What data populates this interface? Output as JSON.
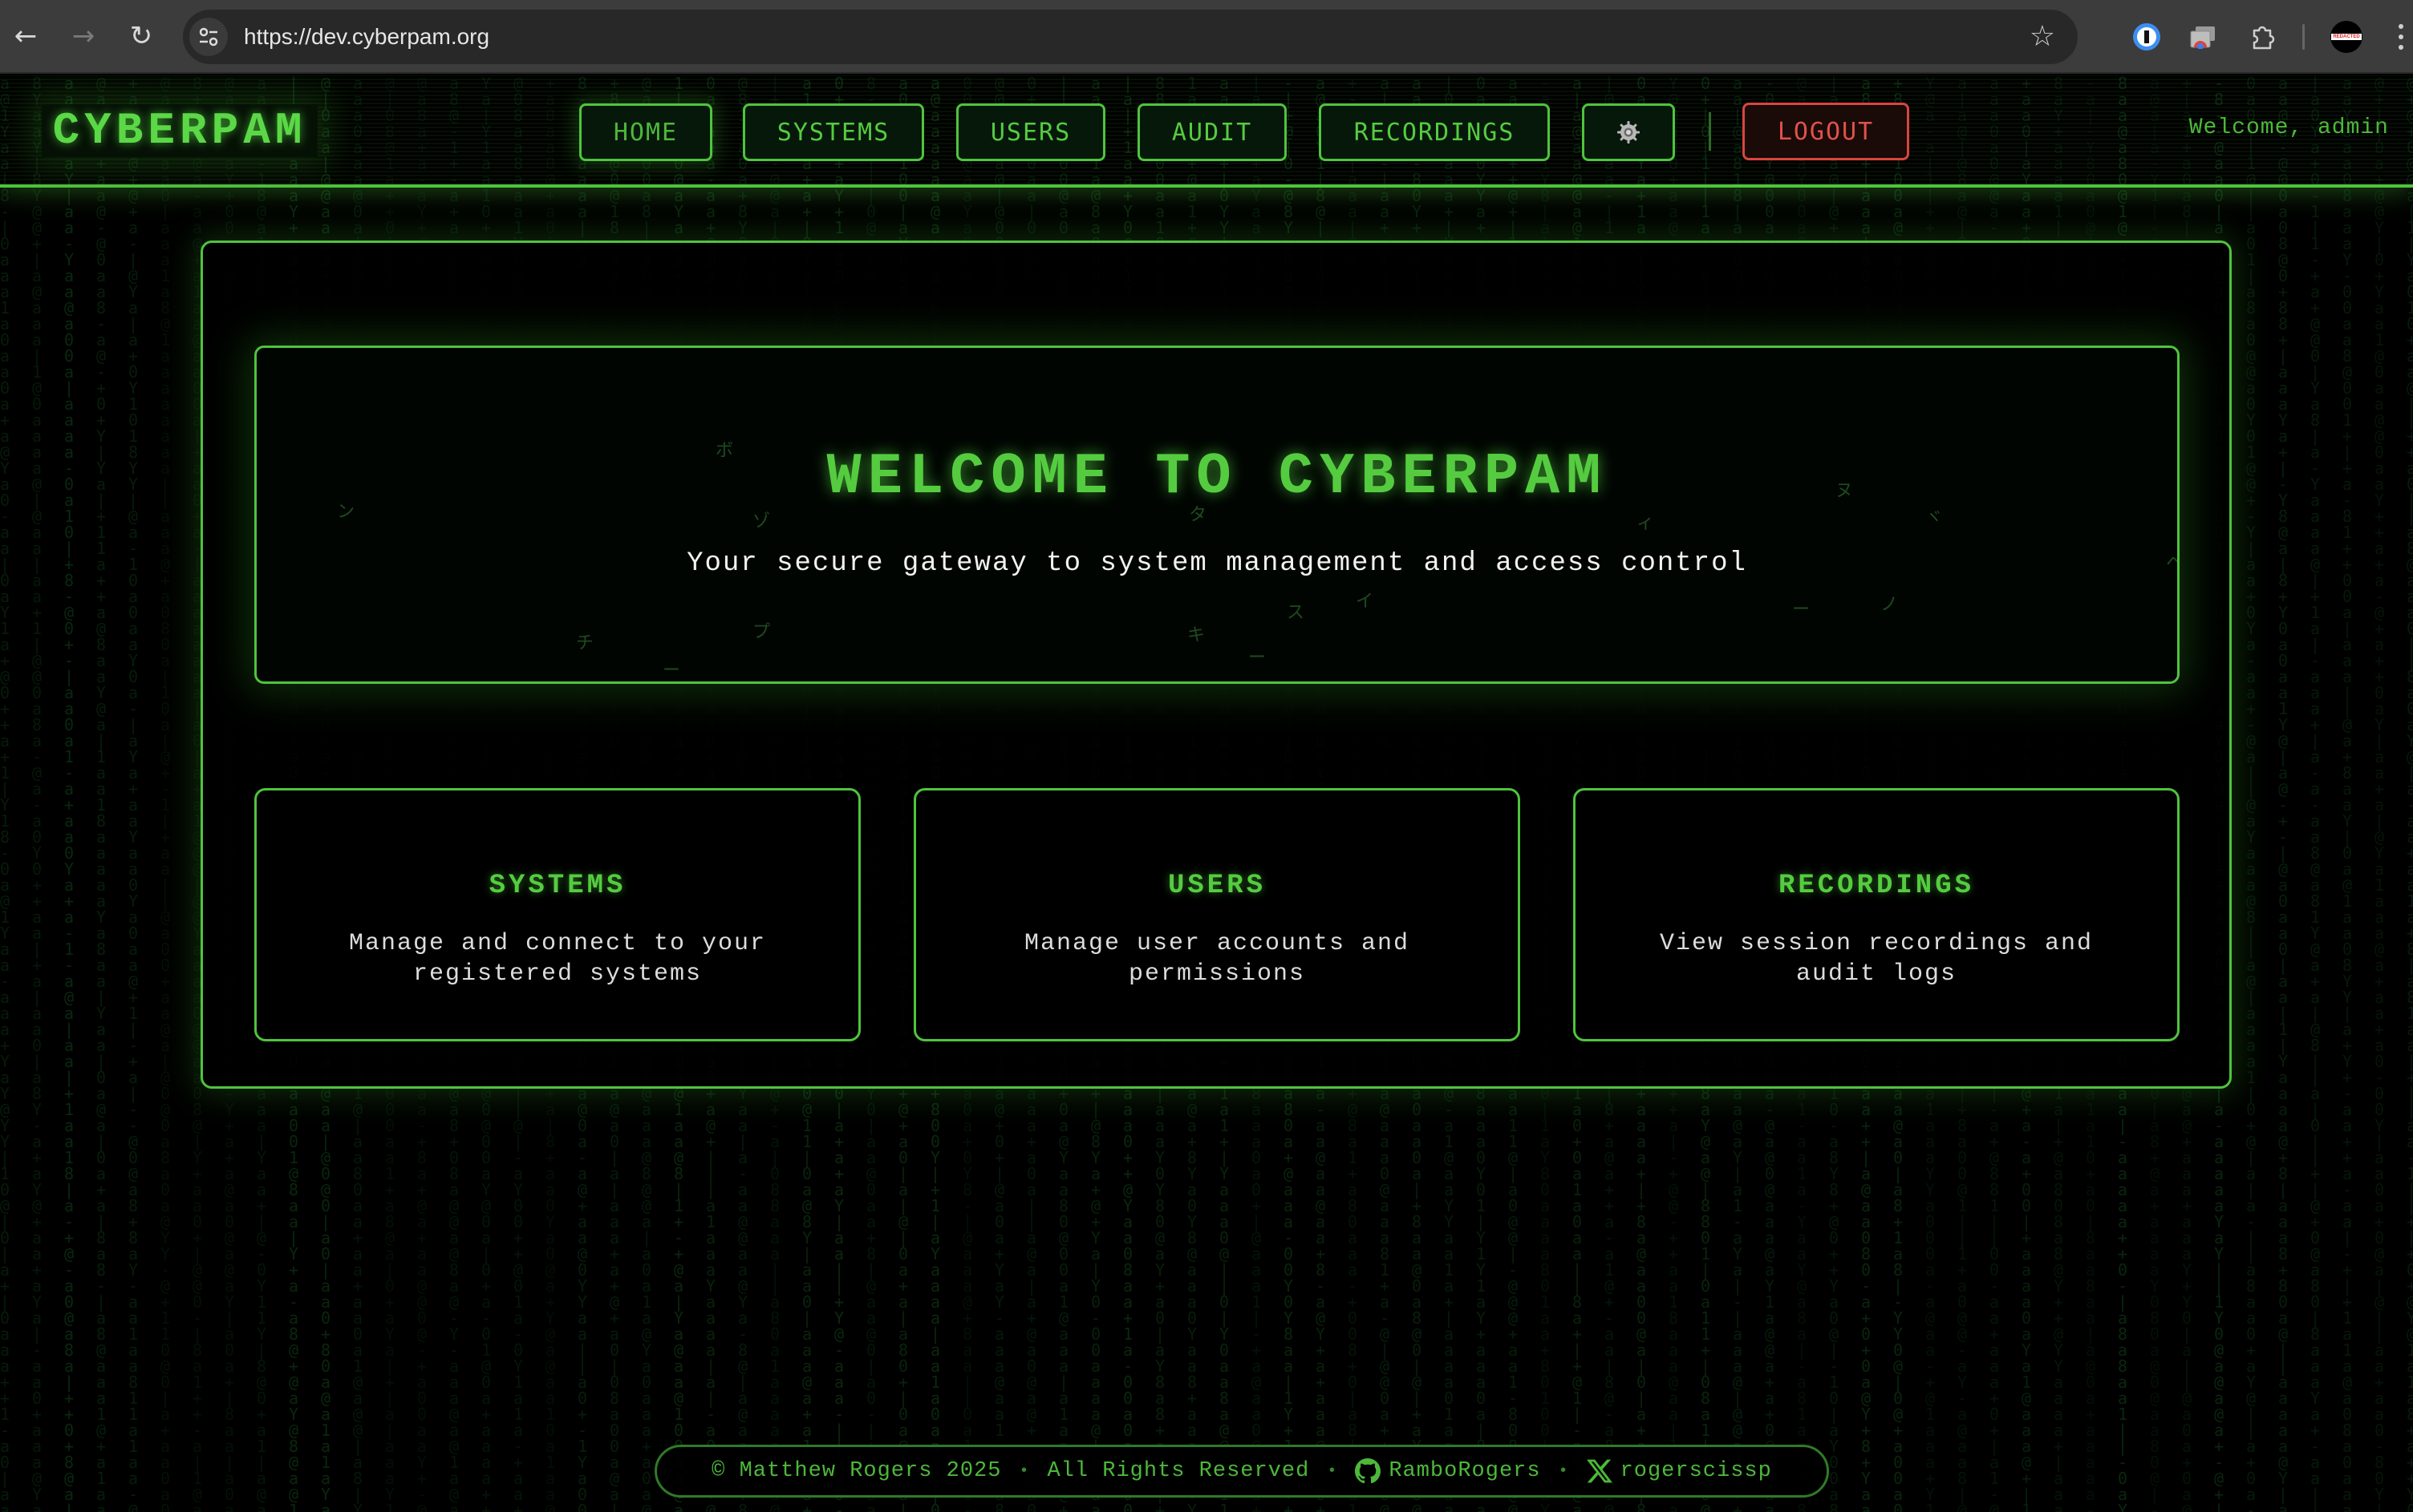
{
  "browser": {
    "url": "https://dev.cyberpam.org",
    "profile_badge": "REDACTED",
    "icons": [
      "back-icon",
      "forward-icon",
      "reload-icon",
      "site-info-icon",
      "bookmark-star-icon",
      "1password-icon",
      "cast-icon",
      "extensions-icon",
      "profile-avatar",
      "more-menu-icon"
    ]
  },
  "header": {
    "logo": "CYBERPAM",
    "nav": [
      {
        "label": "HOME",
        "active": true
      },
      {
        "label": "SYSTEMS"
      },
      {
        "label": "USERS"
      },
      {
        "label": "AUDIT"
      },
      {
        "label": "RECORDINGS"
      }
    ],
    "settings_icon": "gear-icon",
    "logout_label": "LOGOUT",
    "welcome": "Welcome, admin"
  },
  "hero": {
    "title": "WELCOME TO CYBERPAM",
    "subtitle": "Your secure gateway to system management and access control",
    "katakana": [
      "ボ",
      "ン",
      "ゾ",
      "タ",
      "ィ",
      "ヌ",
      "ヾ",
      "チ",
      "プ",
      "キ",
      "ス",
      "イ",
      "ー",
      "ノ",
      "ー",
      "ー",
      "ヘ"
    ]
  },
  "cards": [
    {
      "title": "SYSTEMS",
      "description": "Manage and connect to your registered systems"
    },
    {
      "title": "USERS",
      "description": "Manage user accounts and permissions"
    },
    {
      "title": "RECORDINGS",
      "description": "View session recordings and audit logs"
    }
  ],
  "footer": {
    "copyright": "© Matthew Rogers 2025",
    "rights": "All Rights Reserved",
    "separator": "•",
    "github": {
      "icon": "github-icon",
      "handle": "RamboRogers"
    },
    "x": {
      "icon": "x-icon",
      "handle": "rogerscissp"
    }
  },
  "colors": {
    "accent": "#4fc43d",
    "accent_text": "#55cc40",
    "logout": "#d9453f",
    "background": "#000000"
  }
}
